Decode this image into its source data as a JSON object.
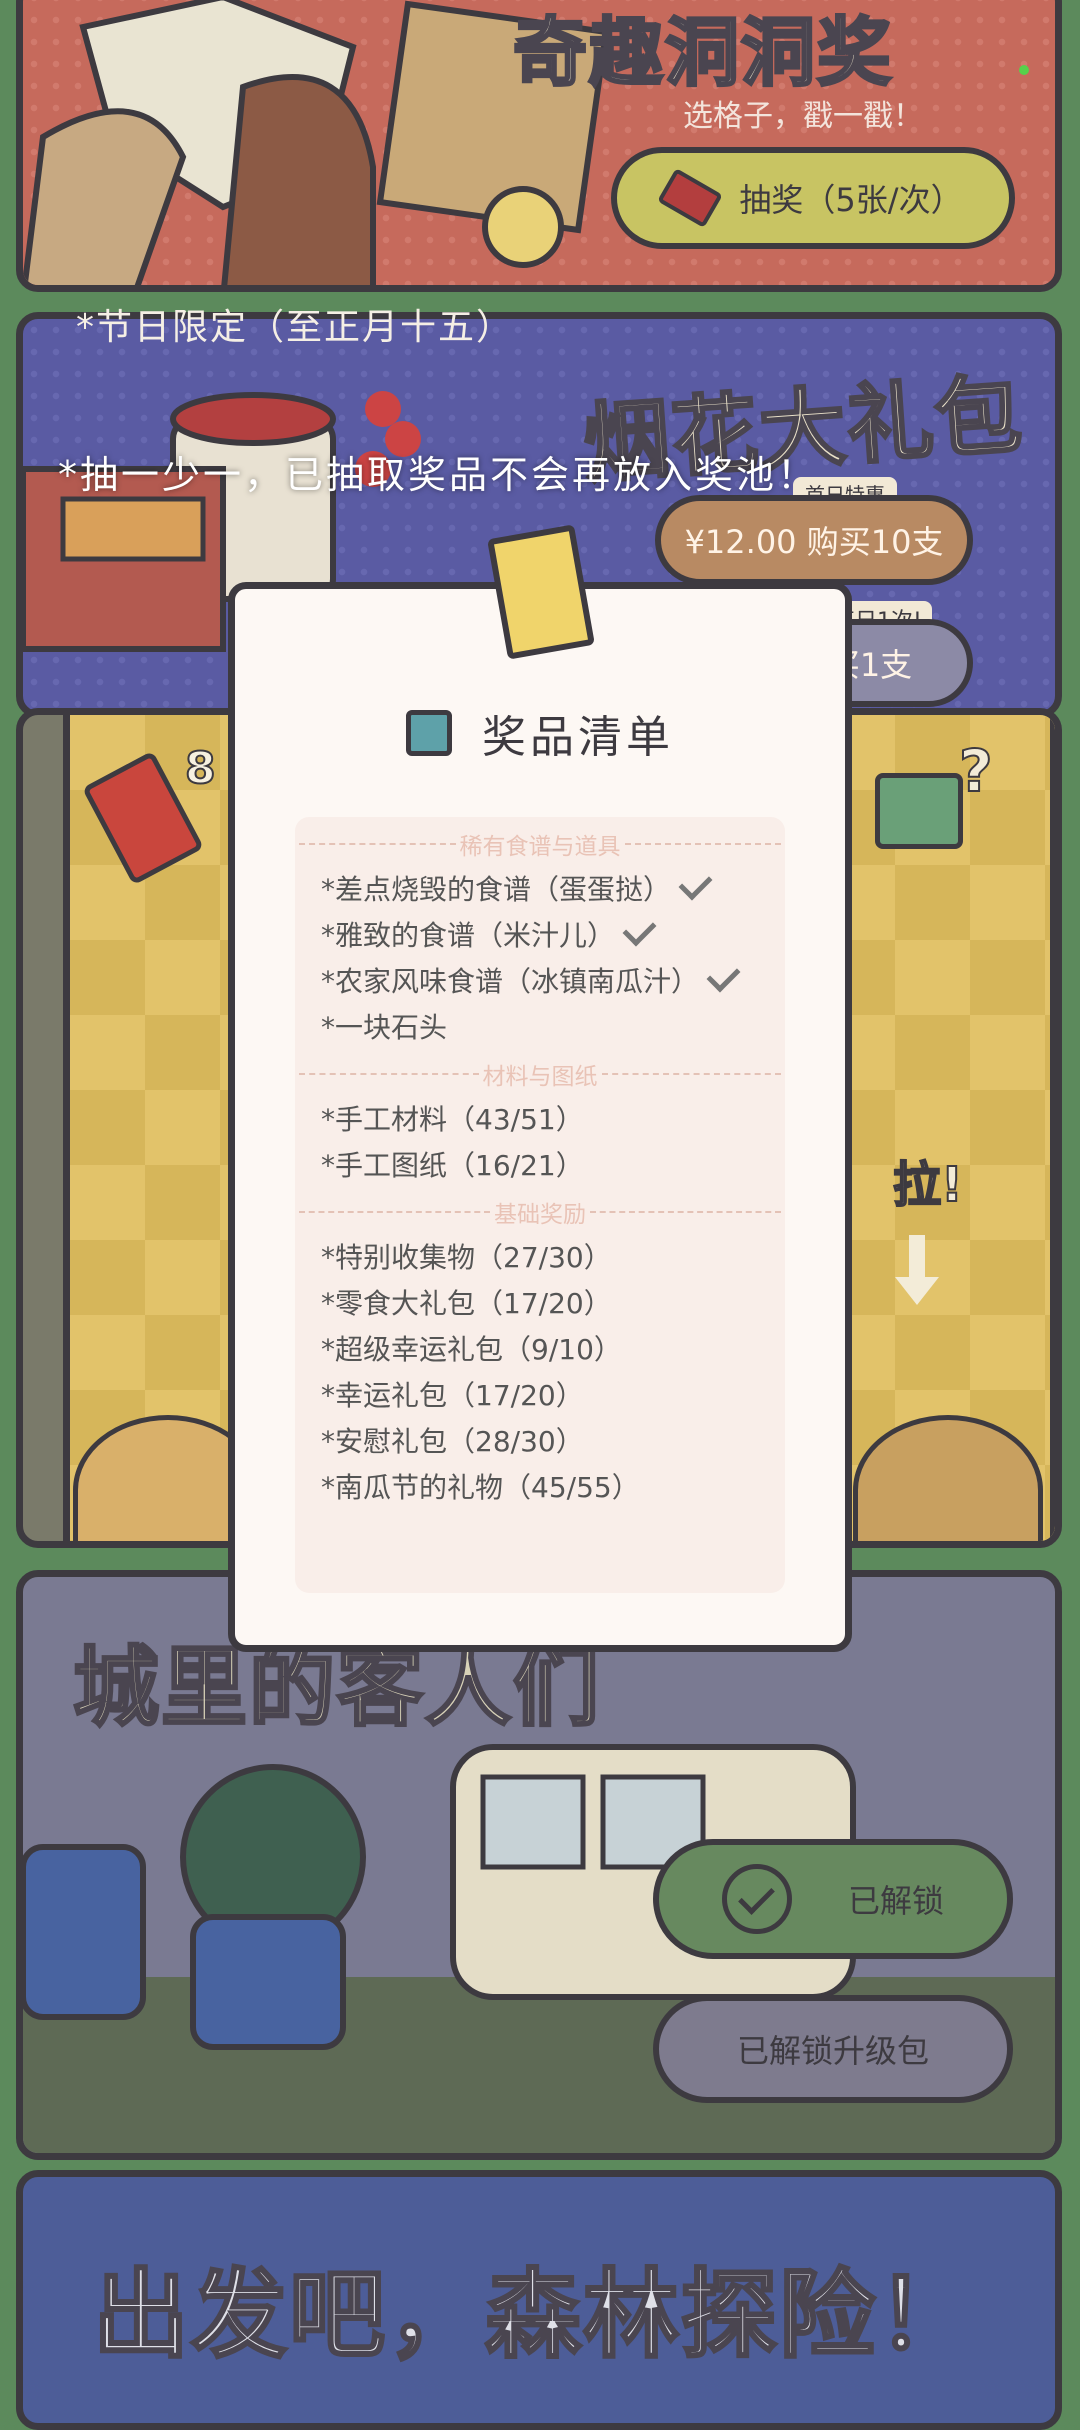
{
  "top_card": {
    "title": "奇趣洞洞奖",
    "subtitle": "选格子，戳一戳！",
    "draw_button": "抽奖（5张/次）"
  },
  "holiday_note": "*节日限定（至正月十五）",
  "fireworks_card": {
    "title": "烟花大礼包",
    "buy10_tag": "首日特惠",
    "buy10_button": "¥12.00 购买10支",
    "buy1_tag": "每日1次!",
    "buy1_button": "购买1支"
  },
  "toast": "*抽一少一，已抽取奖品不会再放入奖池！",
  "game": {
    "ticket_count": "8",
    "pull_label": "拉!",
    "mystery_mark": "?"
  },
  "modal": {
    "title": "奖品清单",
    "sections": [
      {
        "header": "稀有食谱与道具",
        "items": [
          {
            "label": "*差点烧毁的食谱（蛋蛋挞）",
            "checked": true
          },
          {
            "label": "*雅致的食谱（米汁儿）",
            "checked": true
          },
          {
            "label": "*农家风味食谱（冰镇南瓜汁）",
            "checked": true
          },
          {
            "label": "*一块石头",
            "checked": false
          }
        ]
      },
      {
        "header": "材料与图纸",
        "items": [
          {
            "label": "*手工材料（43/51）",
            "checked": false
          },
          {
            "label": "*手工图纸（16/21）",
            "checked": false
          }
        ]
      },
      {
        "header": "基础奖励",
        "items": [
          {
            "label": "*特别收集物（27/30）",
            "checked": false
          },
          {
            "label": "*零食大礼包（17/20）",
            "checked": false
          },
          {
            "label": "*超级幸运礼包（9/10）",
            "checked": false
          },
          {
            "label": "*幸运礼包（17/20）",
            "checked": false
          },
          {
            "label": "*安慰礼包（28/30）",
            "checked": false
          },
          {
            "label": "*南瓜节的礼物（45/55）",
            "checked": false
          }
        ]
      }
    ]
  },
  "guest_card": {
    "title": "城里的客人们",
    "unlocked_button": "已解锁",
    "upgrade_button": "已解锁升级包"
  },
  "forest_card": {
    "title": "出发吧，森林探险！"
  }
}
